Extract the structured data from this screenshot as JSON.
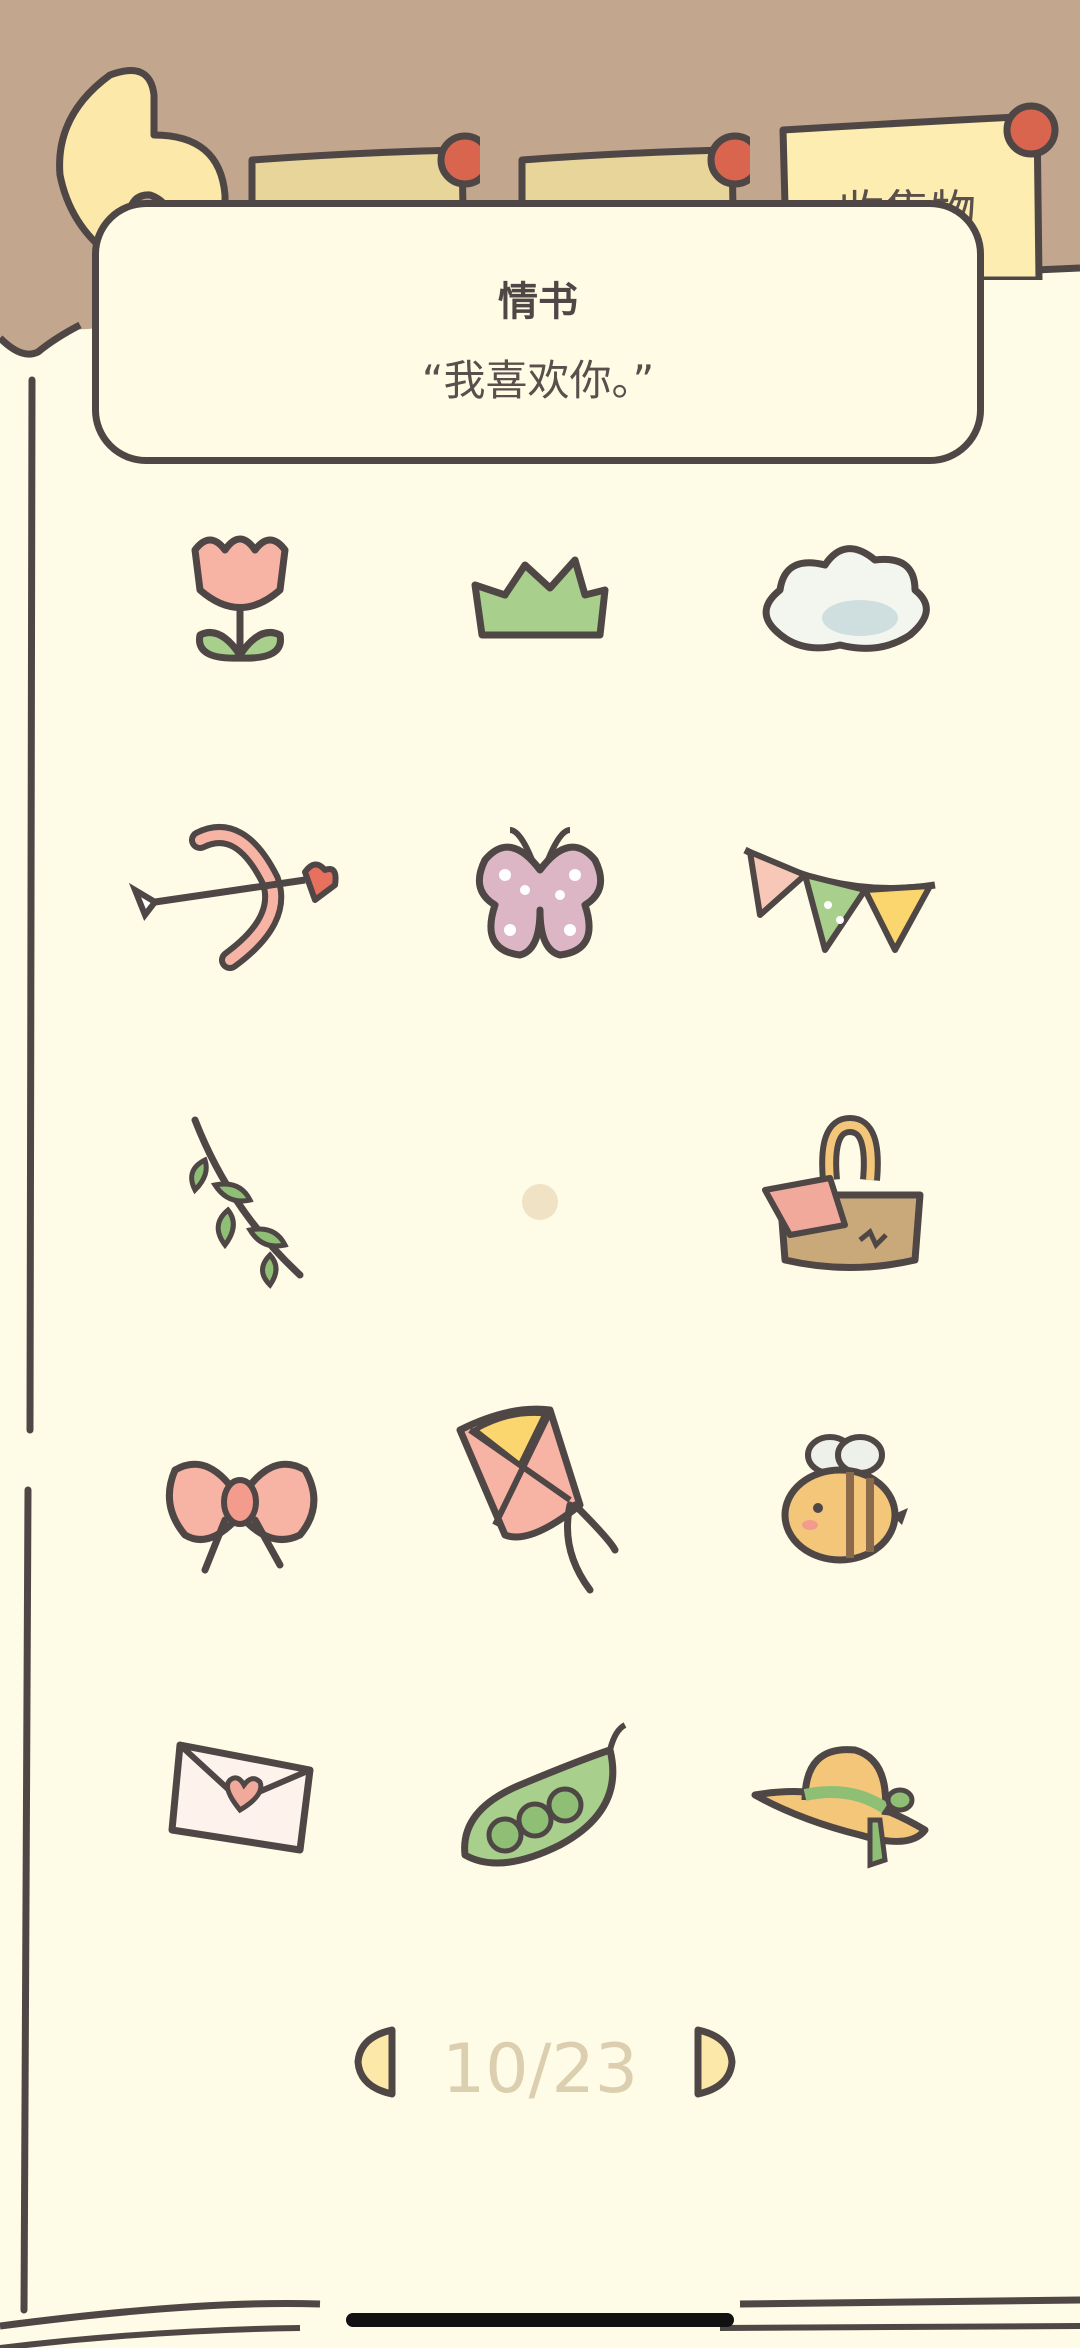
{
  "tabs": [
    {
      "label": ""
    },
    {
      "label": ""
    },
    {
      "label": "收集物"
    }
  ],
  "popup": {
    "title": "情书",
    "text": "“我喜欢你。”"
  },
  "grid": [
    {
      "icon": "tulip-icon"
    },
    {
      "icon": "grass-icon"
    },
    {
      "icon": "cloud-icon"
    },
    {
      "icon": "cupid-bow-icon"
    },
    {
      "icon": "butterfly-icon"
    },
    {
      "icon": "bunting-icon"
    },
    {
      "icon": "leaf-branch-icon"
    },
    {
      "icon": "empty-slot"
    },
    {
      "icon": "picnic-basket-icon"
    },
    {
      "icon": "bow-ribbon-icon"
    },
    {
      "icon": "kite-icon"
    },
    {
      "icon": "bee-icon"
    },
    {
      "icon": "love-letter-icon"
    },
    {
      "icon": "peapod-icon"
    },
    {
      "icon": "straw-hat-icon"
    }
  ],
  "pagination": {
    "current": "10/23"
  },
  "colors": {
    "background": "#c3a68e",
    "paper": "#fefbe6",
    "outline": "#4f4646",
    "pin": "#d9654f",
    "tab": "#f0dc9c",
    "page_num": "#dccfb0"
  }
}
